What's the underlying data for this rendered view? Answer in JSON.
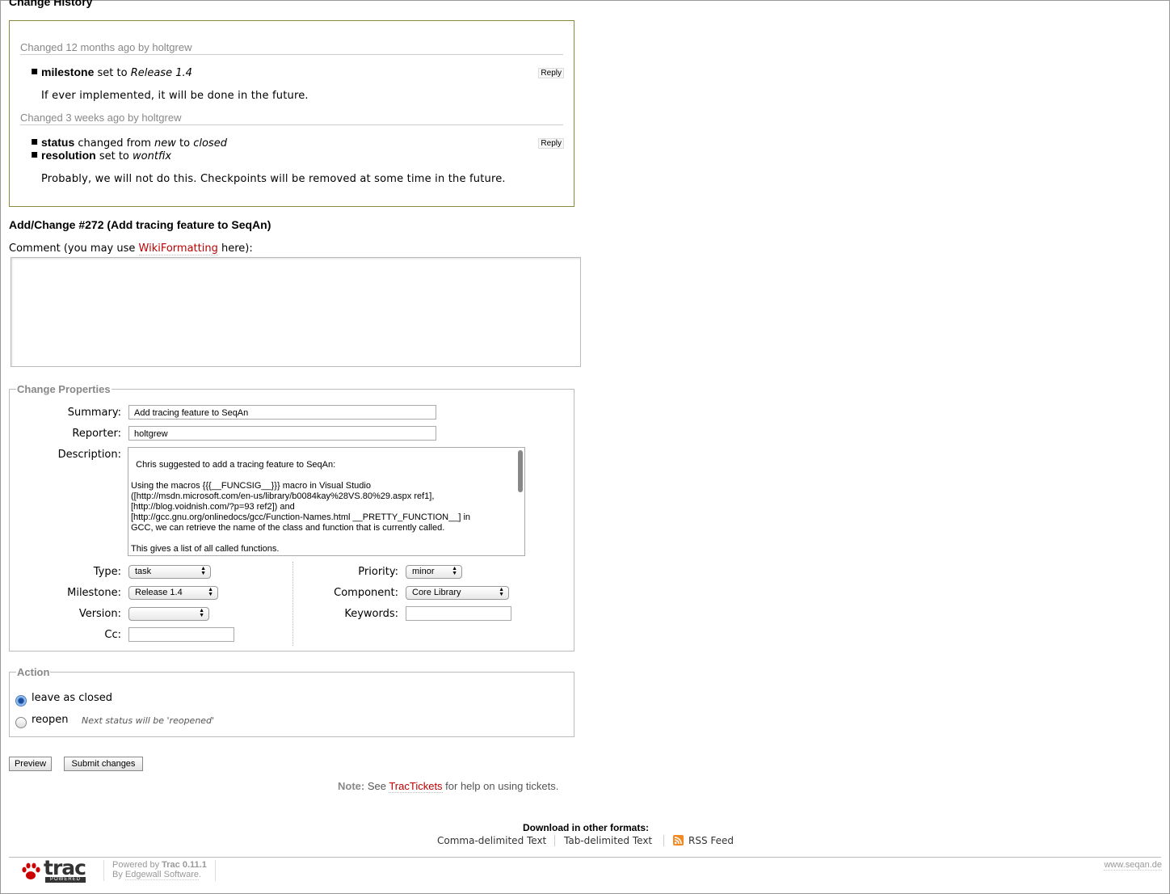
{
  "history": {
    "title": "Change History",
    "changes": [
      {
        "header": "Changed 12 months ago by holtgrew",
        "reply": "Reply",
        "props": [
          {
            "name": "milestone",
            "verb": "set to",
            "value": "Release 1.4"
          }
        ],
        "comment": "If ever implemented, it will be done in the future."
      },
      {
        "header": "Changed 3 weeks ago by holtgrew",
        "reply": "Reply",
        "props": [
          {
            "name": "status",
            "verb": "changed from",
            "from": "new",
            "to_word": "to",
            "value": "closed"
          },
          {
            "name": "resolution",
            "verb": "set to",
            "value": "wontfix"
          }
        ],
        "comment": "Probably, we will not do this. Checkpoints will be removed at some time in the future."
      }
    ]
  },
  "add_change": {
    "title": "Add/Change #272 (Add tracing feature to SeqAn)",
    "comment_label_pre": "Comment (you may use ",
    "comment_link": "WikiFormatting",
    "comment_label_post": " here):",
    "comment_value": ""
  },
  "properties": {
    "legend": "Change Properties",
    "summary_label": "Summary:",
    "summary_value": "Add tracing feature to SeqAn",
    "reporter_label": "Reporter:",
    "reporter_value": "holtgrew",
    "description_label": "Description:",
    "description_value": "Chris suggested to add a tracing feature to SeqAn:\n\nUsing the macros {{{__FUNCSIG__}}} macro in Visual Studio\n([http://msdn.microsoft.com/en-us/library/b0084kay%28VS.80%29.aspx ref1],\n[http://blog.voidnish.com/?p=93 ref2]) and\n[http://gcc.gnu.org/onlinedocs/gcc/Function-Names.html __PRETTY_FUNCTION__] in\nGCC, we can retrieve the name of the class and function that is currently called.\n\nThis gives a list of all called functions.\nSome kind of run time introspection should enable us to get the current call stack depth,",
    "type_label": "Type:",
    "type_value": "task",
    "milestone_label": "Milestone:",
    "milestone_value": "Release 1.4",
    "version_label": "Version:",
    "version_value": "",
    "cc_label": "Cc:",
    "cc_value": "",
    "priority_label": "Priority:",
    "priority_value": "minor",
    "component_label": "Component:",
    "component_value": "Core Library",
    "keywords_label": "Keywords:",
    "keywords_value": ""
  },
  "action": {
    "legend": "Action",
    "options": [
      {
        "label": "leave as closed",
        "selected": true,
        "hint": ""
      },
      {
        "label": "reopen",
        "selected": false,
        "hint": "Next status will be 'reopened'"
      }
    ]
  },
  "buttons": {
    "preview": "Preview",
    "submit": "Submit changes"
  },
  "note": {
    "bold": "Note:",
    "pre": " See ",
    "link": "TracTickets",
    "post": " for help on using tickets."
  },
  "download": {
    "label": "Download in other formats:",
    "formats": [
      "Comma-delimited Text",
      "Tab-delimited Text",
      "RSS Feed"
    ]
  },
  "footer": {
    "logo_text": "trac",
    "logo_sub": "POWERED",
    "powered_pre": "Powered by ",
    "powered_product": "Trac 0.11.1",
    "by_pre": "By ",
    "by_link": "Edgewall Software",
    "by_post": ".",
    "site_link": "www.seqan.de"
  },
  "colors": {
    "link": "#bb0000",
    "history_border": "#8a8a3c",
    "rss": "#f08a24"
  }
}
